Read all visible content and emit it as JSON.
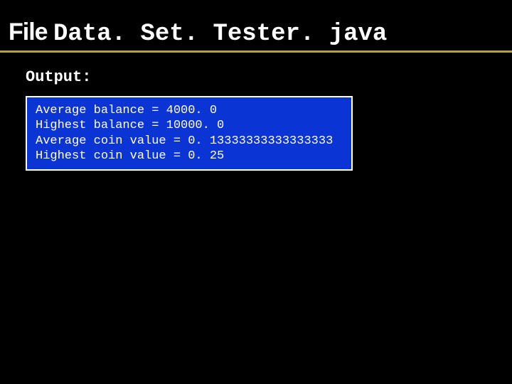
{
  "title": {
    "prefix": "File ",
    "filename": "Data. Set. Tester. java"
  },
  "output_label": "Output:",
  "output_lines": [
    "Average balance = 4000. 0",
    "Highest balance = 10000. 0",
    "Average coin value = 0. 13333333333333333",
    "Highest coin value = 0. 25"
  ]
}
